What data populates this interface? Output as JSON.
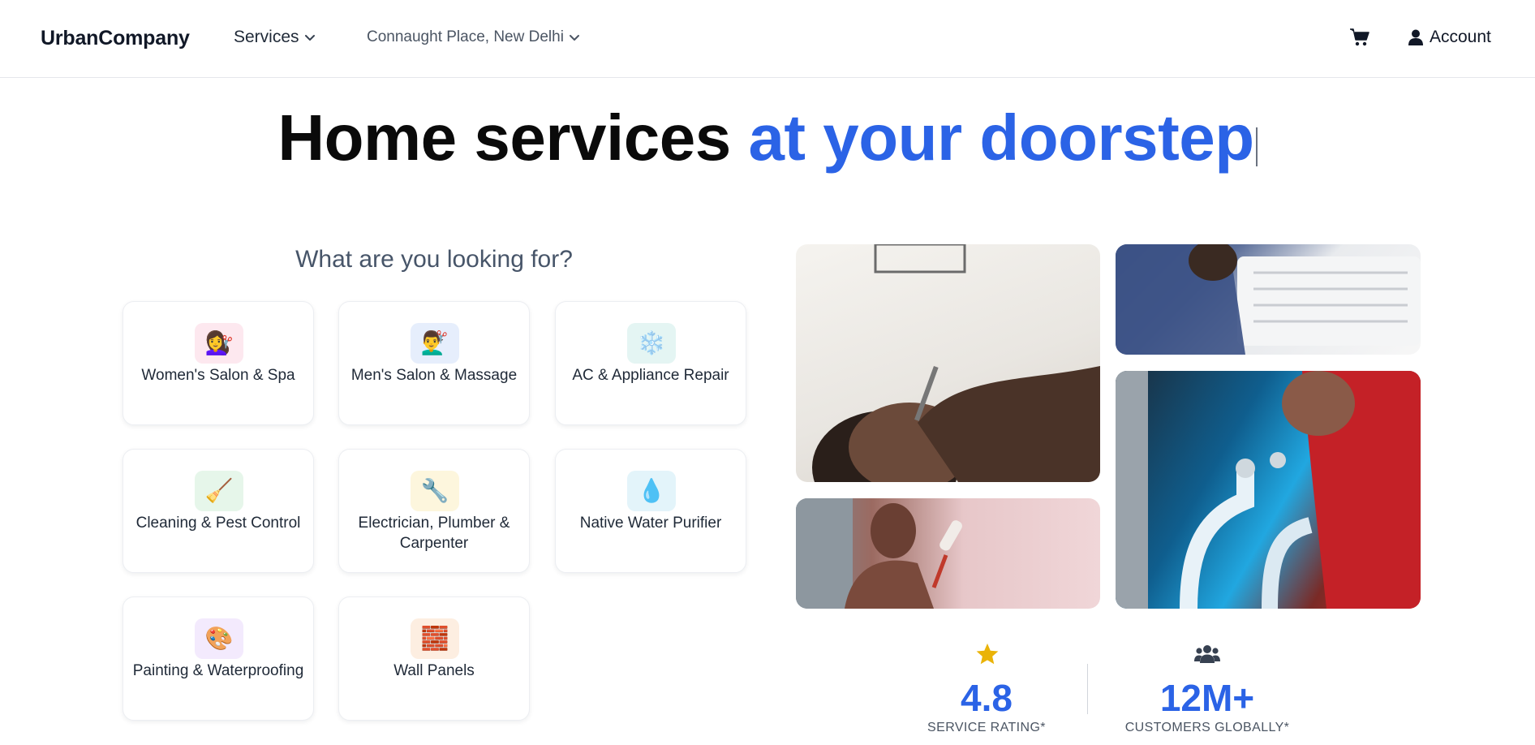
{
  "nav": {
    "logo": "UrbanCompany",
    "services_label": "Services",
    "location": "Connaught Place, New Delhi",
    "account_label": "Account"
  },
  "hero": {
    "part1": "Home services",
    "part2": "at your doorstep"
  },
  "categories": {
    "heading": "What are you looking for?",
    "items": [
      {
        "label": "Women's Salon & Spa",
        "icon": "woman-haircut-icon",
        "glyph": "💇‍♀️",
        "bg": "#fde8ef"
      },
      {
        "label": "Men's Salon & Massage",
        "icon": "man-haircut-icon",
        "glyph": "💇‍♂️",
        "bg": "#e6eefc"
      },
      {
        "label": "AC & Appliance Repair",
        "icon": "snowflake-icon",
        "glyph": "❄️",
        "bg": "#e4f5f3"
      },
      {
        "label": "Cleaning & Pest Control",
        "icon": "broom-icon",
        "glyph": "🧹",
        "bg": "#e6f6ea"
      },
      {
        "label": "Electrician, Plumber & Carpenter",
        "icon": "wrench-icon",
        "glyph": "🔧",
        "bg": "#fdf6dd"
      },
      {
        "label": "Native Water Purifier",
        "icon": "droplet-icon",
        "glyph": "💧",
        "bg": "#e3f4fa"
      },
      {
        "label": "Painting & Waterproofing",
        "icon": "palette-icon",
        "glyph": "🎨",
        "bg": "#f3eafd"
      },
      {
        "label": "Wall Panels",
        "icon": "bricks-icon",
        "glyph": "🧱",
        "bg": "#fdeee1"
      }
    ]
  },
  "stats": [
    {
      "value": "4.8",
      "label": "SERVICE RATING*",
      "icon": "star-icon"
    },
    {
      "value": "12M+",
      "label": "CUSTOMERS GLOBALLY*",
      "icon": "users-icon"
    }
  ],
  "colors": {
    "accent": "#2b63e6",
    "star": "#eab308"
  }
}
